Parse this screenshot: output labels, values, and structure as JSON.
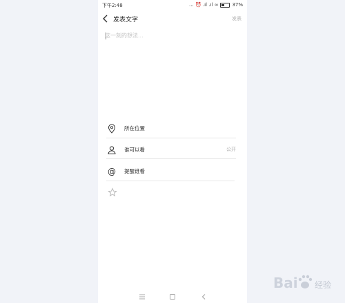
{
  "status_bar": {
    "time": "下午2:48",
    "right_text": "... ⏰ .ıl .ıl ≈",
    "battery": "37%"
  },
  "header": {
    "title": "发表文字",
    "send_label": "发表"
  },
  "compose": {
    "placeholder": "这一刻的想法..."
  },
  "options": [
    {
      "icon": "location-pin-icon",
      "label": "所在位置",
      "value": ""
    },
    {
      "icon": "person-icon",
      "label": "谁可以看",
      "value": "公开"
    },
    {
      "icon": "at-sign-icon",
      "label": "提醒谁看",
      "value": ""
    }
  ],
  "nav": {
    "icons": [
      "menu-icon",
      "home-square-icon",
      "back-arrow-icon"
    ]
  },
  "watermark": {
    "brand": "Bai",
    "suffix": "经验",
    "icon": "paw-logo-icon"
  },
  "colors": {
    "background": "#f1f3f8",
    "panel": "#ffffff",
    "muted": "#b5b5b5",
    "text": "#333333"
  }
}
